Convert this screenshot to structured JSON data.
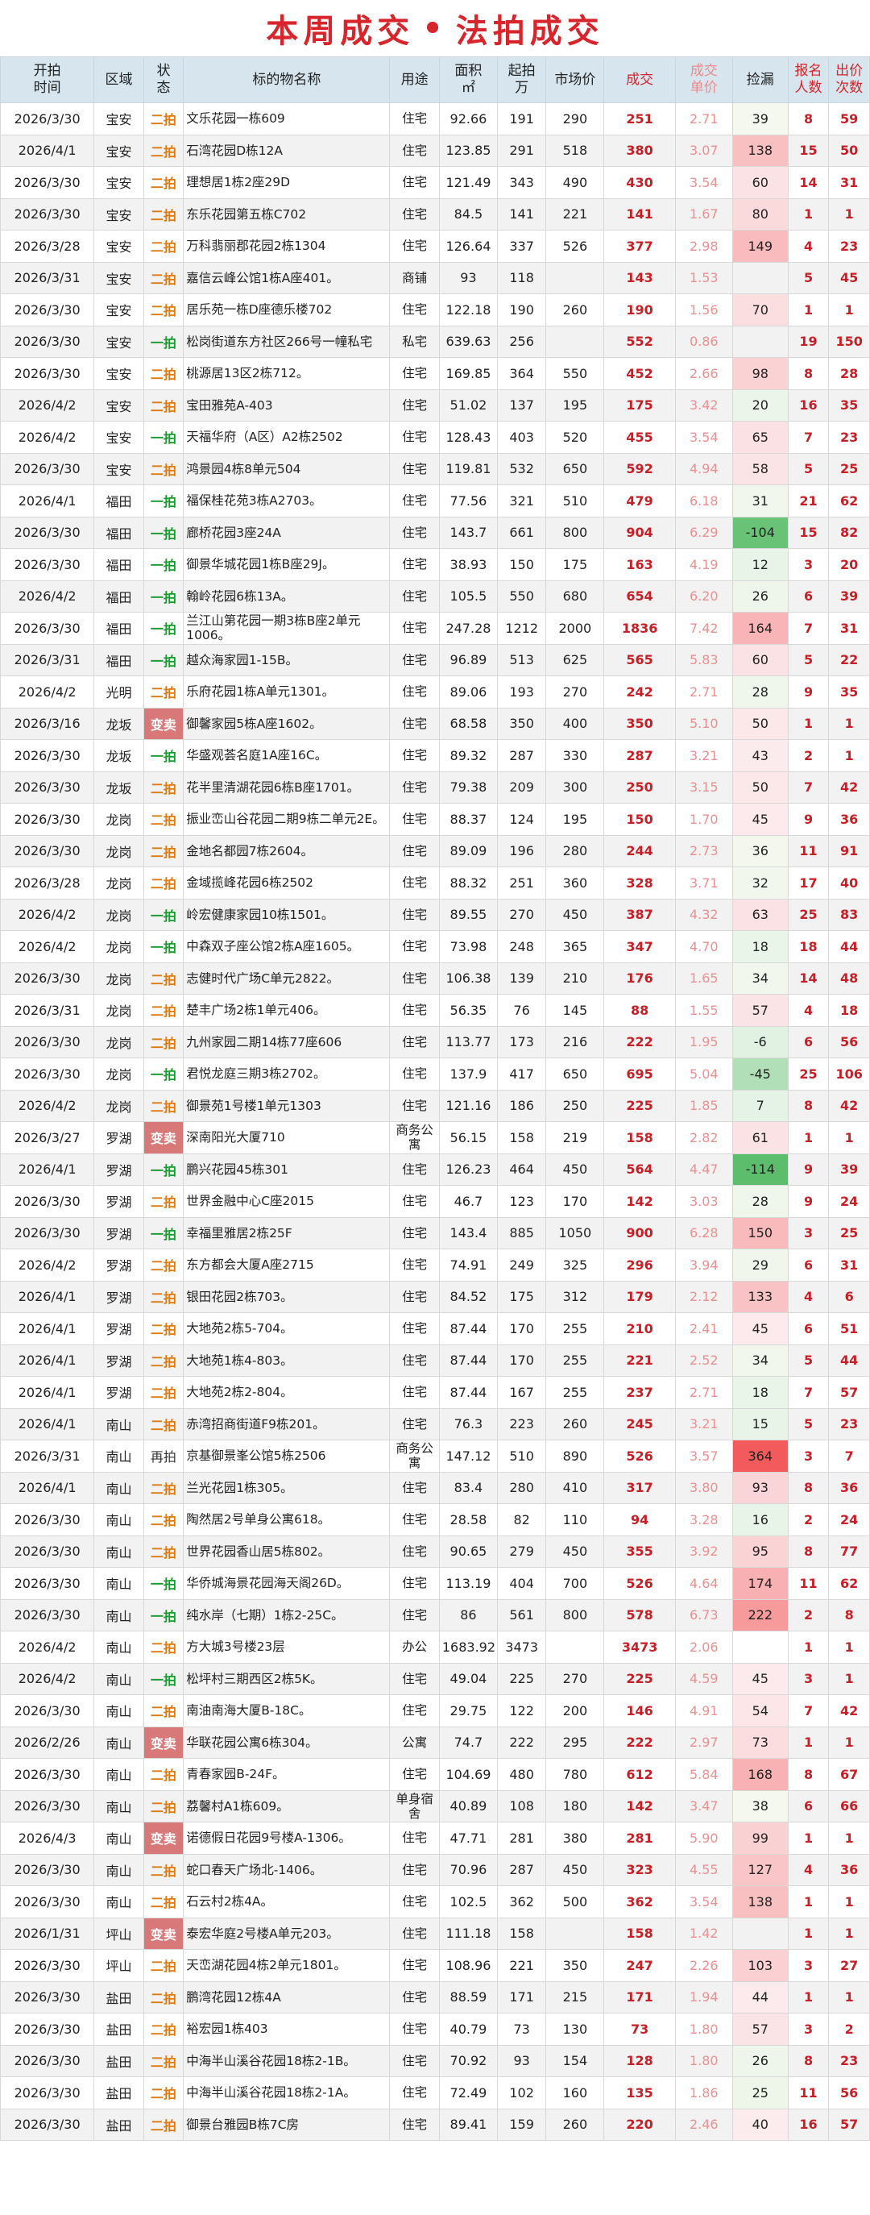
{
  "title": {
    "left": "本周成交",
    "dot": "•",
    "right": "法拍成交"
  },
  "headers": [
    "开拍\n时间",
    "区域",
    "状\n态",
    "标的物名称",
    "用途",
    "面积\n㎡",
    "起拍\n万",
    "市场价",
    "成交",
    "成交\n单价",
    "捡漏",
    "报名\n人数",
    "出价\n次数"
  ],
  "colors": {
    "title": "#d8242b",
    "header_bg": "#d6e5ee",
    "status_er": "#e07a10",
    "status_yi": "#189a2e",
    "status_bian": "#d97878",
    "deal": "#c81e25",
    "unit": "#ef8f8f",
    "jl_green": "#4caf50",
    "jl_red": "#f15a5a"
  },
  "rows": [
    [
      "2026/3/30",
      "宝安",
      "二拍",
      "文乐花园一栋609",
      "住宅",
      "92.66",
      "191",
      "290",
      "251",
      "2.71",
      "39",
      "8",
      "59"
    ],
    [
      "2026/4/1",
      "宝安",
      "二拍",
      "石湾花园D栋12A",
      "住宅",
      "123.85",
      "291",
      "518",
      "380",
      "3.07",
      "138",
      "15",
      "50"
    ],
    [
      "2026/3/30",
      "宝安",
      "二拍",
      "理想居1栋2座29D",
      "住宅",
      "121.49",
      "343",
      "490",
      "430",
      "3.54",
      "60",
      "14",
      "31"
    ],
    [
      "2026/3/30",
      "宝安",
      "二拍",
      "东乐花园第五栋C702",
      "住宅",
      "84.5",
      "141",
      "221",
      "141",
      "1.67",
      "80",
      "1",
      "1"
    ],
    [
      "2026/3/28",
      "宝安",
      "二拍",
      "万科翡丽郡花园2栋1304",
      "住宅",
      "126.64",
      "337",
      "526",
      "377",
      "2.98",
      "149",
      "4",
      "23"
    ],
    [
      "2026/3/31",
      "宝安",
      "二拍",
      "嘉信云峰公馆1栋A座401。",
      "商铺",
      "93",
      "118",
      "",
      "143",
      "1.53",
      "",
      "5",
      "45"
    ],
    [
      "2026/3/30",
      "宝安",
      "二拍",
      "居乐苑一栋D座德乐楼702",
      "住宅",
      "122.18",
      "190",
      "260",
      "190",
      "1.56",
      "70",
      "1",
      "1"
    ],
    [
      "2026/3/30",
      "宝安",
      "一拍",
      "松岗街道东方社区266号一幢私宅",
      "私宅",
      "639.63",
      "256",
      "",
      "552",
      "0.86",
      "",
      "19",
      "150"
    ],
    [
      "2026/3/30",
      "宝安",
      "二拍",
      "桃源居13区2栋712。",
      "住宅",
      "169.85",
      "364",
      "550",
      "452",
      "2.66",
      "98",
      "8",
      "28"
    ],
    [
      "2026/4/2",
      "宝安",
      "二拍",
      "宝田雅苑A-403",
      "住宅",
      "51.02",
      "137",
      "195",
      "175",
      "3.42",
      "20",
      "16",
      "35"
    ],
    [
      "2026/4/2",
      "宝安",
      "一拍",
      "天福华府（A区）A2栋2502",
      "住宅",
      "128.43",
      "403",
      "520",
      "455",
      "3.54",
      "65",
      "7",
      "23"
    ],
    [
      "2026/3/30",
      "宝安",
      "二拍",
      "鸿景园4栋8单元504",
      "住宅",
      "119.81",
      "532",
      "650",
      "592",
      "4.94",
      "58",
      "5",
      "25"
    ],
    [
      "2026/4/1",
      "福田",
      "一拍",
      "福保桂花苑3栋A2703。",
      "住宅",
      "77.56",
      "321",
      "510",
      "479",
      "6.18",
      "31",
      "21",
      "62"
    ],
    [
      "2026/3/30",
      "福田",
      "一拍",
      "廊桥花园3座24A",
      "住宅",
      "143.7",
      "661",
      "800",
      "904",
      "6.29",
      "-104",
      "15",
      "82"
    ],
    [
      "2026/3/30",
      "福田",
      "一拍",
      "御景华城花园1栋B座29J。",
      "住宅",
      "38.93",
      "150",
      "175",
      "163",
      "4.19",
      "12",
      "3",
      "20"
    ],
    [
      "2026/4/2",
      "福田",
      "一拍",
      "翰岭花园6栋13A。",
      "住宅",
      "105.5",
      "550",
      "680",
      "654",
      "6.20",
      "26",
      "6",
      "39"
    ],
    [
      "2026/3/30",
      "福田",
      "一拍",
      "兰江山第花园一期3栋B座2单元1006。",
      "住宅",
      "247.28",
      "1212",
      "2000",
      "1836",
      "7.42",
      "164",
      "7",
      "31"
    ],
    [
      "2026/3/31",
      "福田",
      "一拍",
      "越众海家园1-15B。",
      "住宅",
      "96.89",
      "513",
      "625",
      "565",
      "5.83",
      "60",
      "5",
      "22"
    ],
    [
      "2026/4/2",
      "光明",
      "二拍",
      "乐府花园1栋A单元1301。",
      "住宅",
      "89.06",
      "193",
      "270",
      "242",
      "2.71",
      "28",
      "9",
      "35"
    ],
    [
      "2026/3/16",
      "龙坂",
      "变卖",
      "御馨家园5栋A座1602。",
      "住宅",
      "68.58",
      "350",
      "400",
      "350",
      "5.10",
      "50",
      "1",
      "1"
    ],
    [
      "2026/3/30",
      "龙坂",
      "一拍",
      "华盛观荟名庭1A座16C。",
      "住宅",
      "89.32",
      "287",
      "330",
      "287",
      "3.21",
      "43",
      "2",
      "1"
    ],
    [
      "2026/3/30",
      "龙坂",
      "二拍",
      "花半里清湖花园6栋B座1701。",
      "住宅",
      "79.38",
      "209",
      "300",
      "250",
      "3.15",
      "50",
      "7",
      "42"
    ],
    [
      "2026/3/30",
      "龙岗",
      "二拍",
      "振业峦山谷花园二期9栋二单元2E。",
      "住宅",
      "88.37",
      "124",
      "195",
      "150",
      "1.70",
      "45",
      "9",
      "36"
    ],
    [
      "2026/3/30",
      "龙岗",
      "二拍",
      "金地名都园7栋2604。",
      "住宅",
      "89.09",
      "196",
      "280",
      "244",
      "2.73",
      "36",
      "11",
      "91"
    ],
    [
      "2026/3/28",
      "龙岗",
      "二拍",
      "金域揽峰花园6栋2502",
      "住宅",
      "88.32",
      "251",
      "360",
      "328",
      "3.71",
      "32",
      "17",
      "40"
    ],
    [
      "2026/4/2",
      "龙岗",
      "一拍",
      "岭宏健康家园10栋1501。",
      "住宅",
      "89.55",
      "270",
      "450",
      "387",
      "4.32",
      "63",
      "25",
      "83"
    ],
    [
      "2026/4/2",
      "龙岗",
      "一拍",
      "中森双子座公馆2栋A座1605。",
      "住宅",
      "73.98",
      "248",
      "365",
      "347",
      "4.70",
      "18",
      "18",
      "44"
    ],
    [
      "2026/3/30",
      "龙岗",
      "二拍",
      "志健时代广场C单元2822。",
      "住宅",
      "106.38",
      "139",
      "210",
      "176",
      "1.65",
      "34",
      "14",
      "48"
    ],
    [
      "2026/3/31",
      "龙岗",
      "二拍",
      "楚丰广场2栋1单元406。",
      "住宅",
      "56.35",
      "76",
      "145",
      "88",
      "1.55",
      "57",
      "4",
      "18"
    ],
    [
      "2026/3/30",
      "龙岗",
      "二拍",
      "九州家园二期14栋77座606",
      "住宅",
      "113.77",
      "173",
      "216",
      "222",
      "1.95",
      "-6",
      "6",
      "56"
    ],
    [
      "2026/3/30",
      "龙岗",
      "一拍",
      "君悦龙庭三期3栋2702。",
      "住宅",
      "137.9",
      "417",
      "650",
      "695",
      "5.04",
      "-45",
      "25",
      "106"
    ],
    [
      "2026/4/2",
      "龙岗",
      "二拍",
      "御景苑1号楼1单元1303",
      "住宅",
      "121.16",
      "186",
      "250",
      "225",
      "1.85",
      "7",
      "8",
      "42"
    ],
    [
      "2026/3/27",
      "罗湖",
      "变卖",
      "深南阳光大厦710",
      "商务公寓",
      "56.15",
      "158",
      "219",
      "158",
      "2.82",
      "61",
      "1",
      "1"
    ],
    [
      "2026/4/1",
      "罗湖",
      "一拍",
      "鹏兴花园45栋301",
      "住宅",
      "126.23",
      "464",
      "450",
      "564",
      "4.47",
      "-114",
      "9",
      "39"
    ],
    [
      "2026/3/30",
      "罗湖",
      "二拍",
      "世界金融中心C座2015",
      "住宅",
      "46.7",
      "123",
      "170",
      "142",
      "3.03",
      "28",
      "9",
      "24"
    ],
    [
      "2026/3/30",
      "罗湖",
      "一拍",
      "幸福里雅居2栋25F",
      "住宅",
      "143.4",
      "885",
      "1050",
      "900",
      "6.28",
      "150",
      "3",
      "25"
    ],
    [
      "2026/4/2",
      "罗湖",
      "二拍",
      "东方都会大厦A座2715",
      "住宅",
      "74.91",
      "249",
      "325",
      "296",
      "3.94",
      "29",
      "6",
      "31"
    ],
    [
      "2026/4/1",
      "罗湖",
      "二拍",
      "银田花园2栋703。",
      "住宅",
      "84.52",
      "175",
      "312",
      "179",
      "2.12",
      "133",
      "4",
      "6"
    ],
    [
      "2026/4/1",
      "罗湖",
      "二拍",
      "大地苑2栋5-704。",
      "住宅",
      "87.44",
      "170",
      "255",
      "210",
      "2.41",
      "45",
      "6",
      "51"
    ],
    [
      "2026/4/1",
      "罗湖",
      "二拍",
      "大地苑1栋4-803。",
      "住宅",
      "87.44",
      "170",
      "255",
      "221",
      "2.52",
      "34",
      "5",
      "44"
    ],
    [
      "2026/4/1",
      "罗湖",
      "二拍",
      "大地苑2栋2-804。",
      "住宅",
      "87.44",
      "167",
      "255",
      "237",
      "2.71",
      "18",
      "7",
      "57"
    ],
    [
      "2026/4/1",
      "南山",
      "二拍",
      "赤湾招商街道F9栋201。",
      "住宅",
      "76.3",
      "223",
      "260",
      "245",
      "3.21",
      "15",
      "5",
      "23"
    ],
    [
      "2026/3/31",
      "南山",
      "再拍",
      "京基御景峯公馆5栋2506",
      "商务公寓",
      "147.12",
      "510",
      "890",
      "526",
      "3.57",
      "364",
      "3",
      "7"
    ],
    [
      "2026/4/1",
      "南山",
      "二拍",
      "兰光花园1栋305。",
      "住宅",
      "83.4",
      "280",
      "410",
      "317",
      "3.80",
      "93",
      "8",
      "36"
    ],
    [
      "2026/3/30",
      "南山",
      "二拍",
      "陶然居2号单身公寓618。",
      "住宅",
      "28.58",
      "82",
      "110",
      "94",
      "3.28",
      "16",
      "2",
      "24"
    ],
    [
      "2026/3/30",
      "南山",
      "二拍",
      "世界花园香山居5栋802。",
      "住宅",
      "90.65",
      "279",
      "450",
      "355",
      "3.92",
      "95",
      "8",
      "77"
    ],
    [
      "2026/3/30",
      "南山",
      "一拍",
      "华侨城海景花园海天阁26D。",
      "住宅",
      "113.19",
      "404",
      "700",
      "526",
      "4.64",
      "174",
      "11",
      "62"
    ],
    [
      "2026/3/30",
      "南山",
      "一拍",
      "纯水岸（七期）1栋2-25C。",
      "住宅",
      "86",
      "561",
      "800",
      "578",
      "6.73",
      "222",
      "2",
      "8"
    ],
    [
      "2026/4/2",
      "南山",
      "二拍",
      "方大城3号楼23层",
      "办公",
      "1683.92",
      "3473",
      "",
      "3473",
      "2.06",
      "",
      "1",
      "1"
    ],
    [
      "2026/4/2",
      "南山",
      "一拍",
      "松坪村三期西区2栋5K。",
      "住宅",
      "49.04",
      "225",
      "270",
      "225",
      "4.59",
      "45",
      "3",
      "1"
    ],
    [
      "2026/3/30",
      "南山",
      "二拍",
      "南油南海大厦B-18C。",
      "住宅",
      "29.75",
      "122",
      "200",
      "146",
      "4.91",
      "54",
      "7",
      "42"
    ],
    [
      "2026/2/26",
      "南山",
      "变卖",
      "华联花园公寓6栋304。",
      "公寓",
      "74.7",
      "222",
      "295",
      "222",
      "2.97",
      "73",
      "1",
      "1"
    ],
    [
      "2026/3/30",
      "南山",
      "二拍",
      "青春家园B-24F。",
      "住宅",
      "104.69",
      "480",
      "780",
      "612",
      "5.84",
      "168",
      "8",
      "67"
    ],
    [
      "2026/3/30",
      "南山",
      "二拍",
      "荔馨村A1栋609。",
      "单身宿舍",
      "40.89",
      "108",
      "180",
      "142",
      "3.47",
      "38",
      "6",
      "66"
    ],
    [
      "2026/4/3",
      "南山",
      "变卖",
      "诺德假日花园9号楼A-1306。",
      "住宅",
      "47.71",
      "281",
      "380",
      "281",
      "5.90",
      "99",
      "1",
      "1"
    ],
    [
      "2026/3/30",
      "南山",
      "二拍",
      "蛇口春天广场北-1406。",
      "住宅",
      "70.96",
      "287",
      "450",
      "323",
      "4.55",
      "127",
      "4",
      "36"
    ],
    [
      "2026/3/30",
      "南山",
      "二拍",
      "石云村2栋4A。",
      "住宅",
      "102.5",
      "362",
      "500",
      "362",
      "3.54",
      "138",
      "1",
      "1"
    ],
    [
      "2026/1/31",
      "坪山",
      "变卖",
      "泰宏华庭2号楼A单元203。",
      "住宅",
      "111.18",
      "158",
      "",
      "158",
      "1.42",
      "",
      "1",
      "1"
    ],
    [
      "2026/3/30",
      "坪山",
      "二拍",
      "天峦湖花园4栋2单元1801。",
      "住宅",
      "108.96",
      "221",
      "350",
      "247",
      "2.26",
      "103",
      "3",
      "27"
    ],
    [
      "2026/3/30",
      "盐田",
      "二拍",
      "鹏湾花园12栋4A",
      "住宅",
      "88.59",
      "171",
      "215",
      "171",
      "1.94",
      "44",
      "1",
      "1"
    ],
    [
      "2026/3/30",
      "盐田",
      "二拍",
      "裕宏园1栋403",
      "住宅",
      "40.79",
      "73",
      "130",
      "73",
      "1.80",
      "57",
      "3",
      "2"
    ],
    [
      "2026/3/30",
      "盐田",
      "二拍",
      "中海半山溪谷花园18栋2-1B。",
      "住宅",
      "70.92",
      "93",
      "154",
      "128",
      "1.80",
      "26",
      "8",
      "23"
    ],
    [
      "2026/3/30",
      "盐田",
      "二拍",
      "中海半山溪谷花园18栋2-1A。",
      "住宅",
      "72.49",
      "102",
      "160",
      "135",
      "1.86",
      "25",
      "11",
      "56"
    ],
    [
      "2026/3/30",
      "盐田",
      "二拍",
      "御景台雅园B栋7C房",
      "住宅",
      "89.41",
      "159",
      "260",
      "220",
      "2.46",
      "40",
      "16",
      "57"
    ]
  ]
}
